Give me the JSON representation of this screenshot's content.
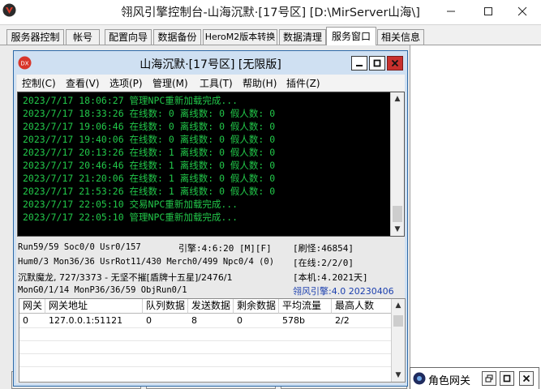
{
  "window": {
    "title": "翎风引擎控制台-山海沉默·[17号区] [D:\\MirServer山海\\]"
  },
  "tabs": [
    {
      "label": "服务器控制"
    },
    {
      "label": "帐号"
    },
    {
      "label": "配置向导"
    },
    {
      "label": "数据备份"
    },
    {
      "label": "HeroM2版本转换"
    },
    {
      "label": "数据清理"
    },
    {
      "label": "服务窗口",
      "active": true
    },
    {
      "label": "相关信息"
    }
  ],
  "inner_window": {
    "title": "山海沉默·[17号区] [无限版]",
    "menu": [
      "控制(C)",
      "查看(V)",
      "选项(P)",
      "管理(M)",
      "工具(T)",
      "帮助(H)",
      "插件(Z)"
    ]
  },
  "console": {
    "lines": [
      "2023/7/17 18:06:27 管理NPC重新加载完成...",
      "2023/7/17 18:33:26 在线数: 0 离线数: 0 假人数: 0",
      "2023/7/17 19:06:46 在线数: 0 离线数: 0 假人数: 0",
      "2023/7/17 19:40:06 在线数: 0 离线数: 0 假人数: 0",
      "2023/7/17 20:13:26 在线数: 1 离线数: 0 假人数: 0",
      "2023/7/17 20:46:46 在线数: 1 离线数: 0 假人数: 0",
      "2023/7/17 21:20:06 在线数: 1 离线数: 0 假人数: 0",
      "2023/7/17 21:53:26 在线数: 1 离线数: 0 假人数: 0",
      "2023/7/17 22:05:10 交易NPC重新加载完成...",
      "2023/7/17 22:05:10 管理NPC重新加载完成..."
    ]
  },
  "status": {
    "run": "Run59/59 Soc0/0 Usr0/157",
    "engine": "引擎:4:6:20 [M][F]",
    "monsters": "[刷怪:46854]",
    "hum": "Hum0/3 Mon36/36 UsrRot11/430 Merch0/499 Npc0/4 (0)",
    "online": "[在线:2/2/0]",
    "player": "沉默魔龙, 727/3373 - 无坚不摧[盾牌十五星]/2476/1",
    "machine": "[本机:4.2021天]",
    "mon": "MonG0/1/14 MonP36/36/59 ObjRun0/1",
    "version": "翎风引擎:4.0 20230406"
  },
  "gateway_table": {
    "headers": [
      "网关",
      "网关地址",
      "队列数据",
      "发送数据",
      "剩余数据",
      "平均流量",
      "最高人数"
    ],
    "rows": [
      [
        "0",
        "127.0.0.1:51121",
        "0",
        "8",
        "0",
        "578b",
        "2/2"
      ]
    ]
  },
  "role_gateway": {
    "title": "角色网关"
  },
  "colors": {
    "console_text": "#22c84a",
    "console_bg": "#000000",
    "version_text": "#1b3fae",
    "close_red": "#c8302d"
  }
}
